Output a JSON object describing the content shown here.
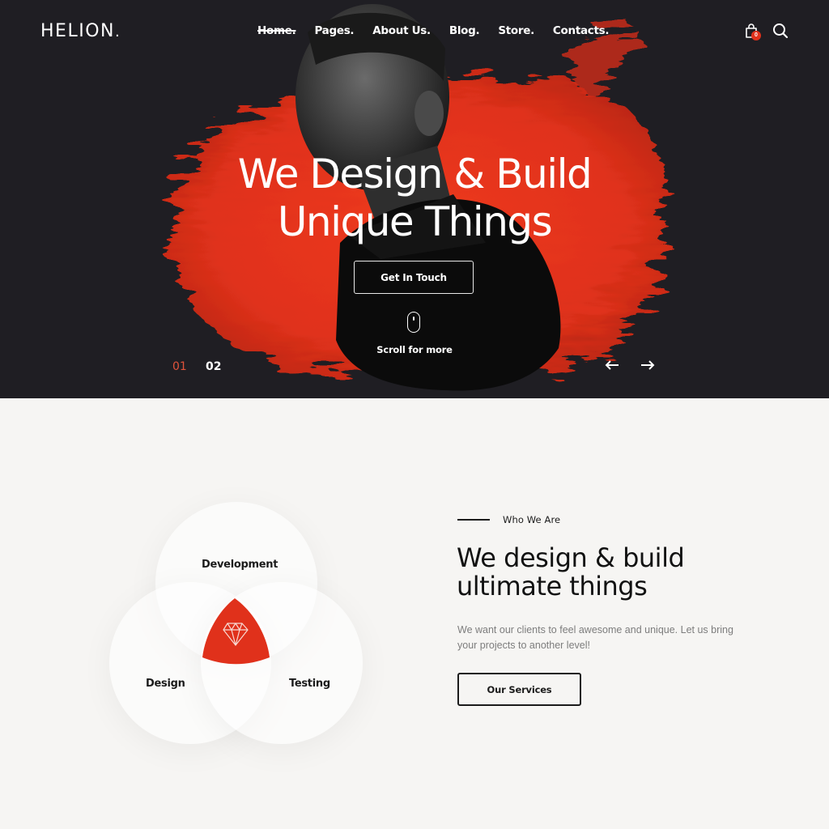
{
  "header": {
    "logo": "HELION",
    "logo_dot": ".",
    "nav": [
      {
        "label": "Home.",
        "active": true
      },
      {
        "label": "Pages.",
        "active": false
      },
      {
        "label": "About Us.",
        "active": false
      },
      {
        "label": "Blog.",
        "active": false
      },
      {
        "label": "Store.",
        "active": false
      },
      {
        "label": "Contacts.",
        "active": false
      }
    ],
    "cart_icon": "shopping-bag-icon",
    "cart_count": "0",
    "search_icon": "search-icon"
  },
  "hero": {
    "title_line1": "We Design & Build",
    "title_line2": "Unique Things",
    "cta_label": "Get In Touch",
    "scroll_icon": "mouse-icon",
    "scroll_label": "Scroll for more",
    "slides": [
      "01",
      "02"
    ],
    "active_slide": "01",
    "prev_icon": "arrow-left-icon",
    "next_icon": "arrow-right-icon"
  },
  "about": {
    "venn": {
      "circles": [
        "Development",
        "Design",
        "Testing"
      ],
      "center_icon": "diamond-icon"
    },
    "eyebrow": "Who We Are",
    "title_line1": "We design & build",
    "title_line2": "ultimate things",
    "description": "We want our clients to feel awesome and unique. Let us bring your projects to another level!",
    "cta_label": "Our Services"
  },
  "colors": {
    "hero_bg": "#1f1e23",
    "accent": "#e0311b",
    "page_bg": "#f6f5f3",
    "text_dark": "#121212",
    "text_muted": "#7d7d7d"
  }
}
